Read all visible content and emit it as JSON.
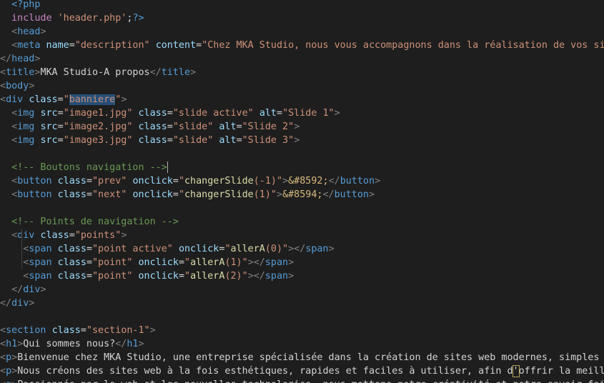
{
  "editor": {
    "language": "php",
    "lines": [
      [
        {
          "t": "  "
        },
        {
          "c": "tag",
          "t": "<?php"
        }
      ],
      [
        {
          "t": "  "
        },
        {
          "c": "php",
          "t": "include"
        },
        {
          "t": " "
        },
        {
          "c": "str",
          "t": "'header.php'"
        },
        {
          "t": ";"
        },
        {
          "c": "tag",
          "t": "?>"
        }
      ],
      [
        {
          "t": "  "
        },
        {
          "c": "punc",
          "t": "<"
        },
        {
          "c": "tag",
          "t": "head"
        },
        {
          "c": "punc",
          "t": ">"
        }
      ],
      [
        {
          "t": "  "
        },
        {
          "c": "punc",
          "t": "<"
        },
        {
          "c": "tag",
          "t": "meta"
        },
        {
          "t": " "
        },
        {
          "c": "attr",
          "t": "name"
        },
        {
          "t": "="
        },
        {
          "c": "str",
          "t": "\"description\""
        },
        {
          "t": " "
        },
        {
          "c": "attr",
          "t": "content"
        },
        {
          "t": "="
        },
        {
          "c": "str",
          "t": "\"Chez MKA Studio, nous vous accompagnons dans la réalisation de vos sites web"
        }
      ],
      [
        {
          "c": "punc",
          "t": "</"
        },
        {
          "c": "tag",
          "t": "head"
        },
        {
          "c": "punc",
          "t": ">"
        }
      ],
      [
        {
          "c": "punc",
          "t": "<"
        },
        {
          "c": "tag",
          "t": "title"
        },
        {
          "c": "punc",
          "t": ">"
        },
        {
          "c": "txt",
          "t": "MKA Studio-A propos"
        },
        {
          "c": "punc",
          "t": "</"
        },
        {
          "c": "tag",
          "t": "title"
        },
        {
          "c": "punc",
          "t": ">"
        }
      ],
      [
        {
          "c": "punc",
          "t": "<"
        },
        {
          "c": "tag",
          "t": "body"
        },
        {
          "c": "punc",
          "t": ">"
        }
      ],
      [
        {
          "c": "punc",
          "t": "<"
        },
        {
          "c": "tag",
          "t": "div"
        },
        {
          "t": " "
        },
        {
          "c": "attr",
          "t": "class"
        },
        {
          "t": "="
        },
        {
          "c": "str",
          "t": "\""
        },
        {
          "c": "str hl",
          "t": "banniere"
        },
        {
          "c": "str",
          "t": "\""
        },
        {
          "c": "punc",
          "t": ">"
        }
      ],
      [
        {
          "t": "  "
        },
        {
          "c": "punc",
          "t": "<"
        },
        {
          "c": "tag",
          "t": "img"
        },
        {
          "t": " "
        },
        {
          "c": "attr",
          "t": "src"
        },
        {
          "t": "="
        },
        {
          "c": "str",
          "t": "\"image1.jpg\""
        },
        {
          "t": " "
        },
        {
          "c": "attr",
          "t": "class"
        },
        {
          "t": "="
        },
        {
          "c": "str",
          "t": "\"slide active\""
        },
        {
          "t": " "
        },
        {
          "c": "attr",
          "t": "alt"
        },
        {
          "t": "="
        },
        {
          "c": "str",
          "t": "\"Slide 1\""
        },
        {
          "c": "punc",
          "t": ">"
        }
      ],
      [
        {
          "t": "  "
        },
        {
          "c": "punc",
          "t": "<"
        },
        {
          "c": "tag",
          "t": "img"
        },
        {
          "t": " "
        },
        {
          "c": "attr",
          "t": "src"
        },
        {
          "t": "="
        },
        {
          "c": "str",
          "t": "\"image2.jpg\""
        },
        {
          "t": " "
        },
        {
          "c": "attr",
          "t": "class"
        },
        {
          "t": "="
        },
        {
          "c": "str",
          "t": "\"slide\""
        },
        {
          "t": " "
        },
        {
          "c": "attr",
          "t": "alt"
        },
        {
          "t": "="
        },
        {
          "c": "str",
          "t": "\"Slide 2\""
        },
        {
          "c": "punc",
          "t": ">"
        }
      ],
      [
        {
          "t": "  "
        },
        {
          "c": "punc",
          "t": "<"
        },
        {
          "c": "tag",
          "t": "img"
        },
        {
          "t": " "
        },
        {
          "c": "attr",
          "t": "src"
        },
        {
          "t": "="
        },
        {
          "c": "str",
          "t": "\"image3.jpg\""
        },
        {
          "t": " "
        },
        {
          "c": "attr",
          "t": "class"
        },
        {
          "t": "="
        },
        {
          "c": "str",
          "t": "\"slide\""
        },
        {
          "t": " "
        },
        {
          "c": "attr",
          "t": "alt"
        },
        {
          "t": "="
        },
        {
          "c": "str",
          "t": "\"Slide 3\""
        },
        {
          "c": "punc",
          "t": ">"
        }
      ],
      [],
      [
        {
          "t": "  "
        },
        {
          "c": "cmt",
          "t": "<!-- Boutons navigation -->"
        }
      ],
      [
        {
          "t": "  "
        },
        {
          "c": "punc",
          "t": "<"
        },
        {
          "c": "tag",
          "t": "button"
        },
        {
          "t": " "
        },
        {
          "c": "attr",
          "t": "class"
        },
        {
          "t": "="
        },
        {
          "c": "str",
          "t": "\"prev\""
        },
        {
          "t": " "
        },
        {
          "c": "attr",
          "t": "onclick"
        },
        {
          "t": "="
        },
        {
          "c": "str",
          "t": "\""
        },
        {
          "c": "fn",
          "t": "changerSlide"
        },
        {
          "c": "str",
          "t": "(-1)\""
        },
        {
          "c": "punc",
          "t": ">"
        },
        {
          "c": "ent",
          "t": "&#8592;"
        },
        {
          "c": "punc",
          "t": "</"
        },
        {
          "c": "tag",
          "t": "button"
        },
        {
          "c": "punc",
          "t": ">"
        }
      ],
      [
        {
          "t": "  "
        },
        {
          "c": "punc",
          "t": "<"
        },
        {
          "c": "tag",
          "t": "button"
        },
        {
          "t": " "
        },
        {
          "c": "attr",
          "t": "class"
        },
        {
          "t": "="
        },
        {
          "c": "str",
          "t": "\"next\""
        },
        {
          "t": " "
        },
        {
          "c": "attr",
          "t": "onclick"
        },
        {
          "t": "="
        },
        {
          "c": "str",
          "t": "\""
        },
        {
          "c": "fn",
          "t": "changerSlide"
        },
        {
          "c": "str",
          "t": "(1)\""
        },
        {
          "c": "punc",
          "t": ">"
        },
        {
          "c": "ent",
          "t": "&#8594;"
        },
        {
          "c": "punc",
          "t": "</"
        },
        {
          "c": "tag",
          "t": "button"
        },
        {
          "c": "punc",
          "t": ">"
        }
      ],
      [],
      [
        {
          "t": "  "
        },
        {
          "c": "cmt",
          "t": "<!-- Points de navigation -->"
        }
      ],
      [
        {
          "t": "  "
        },
        {
          "c": "punc",
          "t": "<"
        },
        {
          "c": "tag",
          "t": "div"
        },
        {
          "t": " "
        },
        {
          "c": "attr",
          "t": "class"
        },
        {
          "t": "="
        },
        {
          "c": "str",
          "t": "\"points\""
        },
        {
          "c": "punc",
          "t": ">"
        }
      ],
      [
        {
          "t": "    "
        },
        {
          "c": "punc",
          "t": "<"
        },
        {
          "c": "tag",
          "t": "span"
        },
        {
          "t": " "
        },
        {
          "c": "attr",
          "t": "class"
        },
        {
          "t": "="
        },
        {
          "c": "str",
          "t": "\"point active\""
        },
        {
          "t": " "
        },
        {
          "c": "attr",
          "t": "onclick"
        },
        {
          "t": "="
        },
        {
          "c": "str",
          "t": "\""
        },
        {
          "c": "fn",
          "t": "allerA"
        },
        {
          "c": "str",
          "t": "(0)\""
        },
        {
          "c": "punc",
          "t": "></"
        },
        {
          "c": "tag",
          "t": "span"
        },
        {
          "c": "punc",
          "t": ">"
        }
      ],
      [
        {
          "t": "    "
        },
        {
          "c": "punc",
          "t": "<"
        },
        {
          "c": "tag",
          "t": "span"
        },
        {
          "t": " "
        },
        {
          "c": "attr",
          "t": "class"
        },
        {
          "t": "="
        },
        {
          "c": "str",
          "t": "\"point\""
        },
        {
          "t": " "
        },
        {
          "c": "attr",
          "t": "onclick"
        },
        {
          "t": "="
        },
        {
          "c": "str",
          "t": "\""
        },
        {
          "c": "fn",
          "t": "allerA"
        },
        {
          "c": "str",
          "t": "(1)\""
        },
        {
          "c": "punc",
          "t": "></"
        },
        {
          "c": "tag",
          "t": "span"
        },
        {
          "c": "punc",
          "t": ">"
        }
      ],
      [
        {
          "t": "    "
        },
        {
          "c": "punc",
          "t": "<"
        },
        {
          "c": "tag",
          "t": "span"
        },
        {
          "t": " "
        },
        {
          "c": "attr",
          "t": "class"
        },
        {
          "t": "="
        },
        {
          "c": "str",
          "t": "\"point\""
        },
        {
          "t": " "
        },
        {
          "c": "attr",
          "t": "onclick"
        },
        {
          "t": "="
        },
        {
          "c": "str",
          "t": "\""
        },
        {
          "c": "fn",
          "t": "allerA"
        },
        {
          "c": "str",
          "t": "(2)\""
        },
        {
          "c": "punc",
          "t": "></"
        },
        {
          "c": "tag",
          "t": "span"
        },
        {
          "c": "punc",
          "t": ">"
        }
      ],
      [
        {
          "t": "  "
        },
        {
          "c": "punc",
          "t": "</"
        },
        {
          "c": "tag",
          "t": "div"
        },
        {
          "c": "punc",
          "t": ">"
        }
      ],
      [
        {
          "c": "punc",
          "t": "</"
        },
        {
          "c": "tag",
          "t": "div"
        },
        {
          "c": "punc",
          "t": ">"
        }
      ],
      [],
      [
        {
          "c": "punc",
          "t": "<"
        },
        {
          "c": "tag",
          "t": "section"
        },
        {
          "t": " "
        },
        {
          "c": "attr",
          "t": "class"
        },
        {
          "t": "="
        },
        {
          "c": "str",
          "t": "\"section-1\""
        },
        {
          "c": "punc",
          "t": ">"
        }
      ],
      [
        {
          "c": "punc",
          "t": "<"
        },
        {
          "c": "tag",
          "t": "h1"
        },
        {
          "c": "punc",
          "t": ">"
        },
        {
          "c": "txt",
          "t": "Qui sommes nous?"
        },
        {
          "c": "punc",
          "t": "</"
        },
        {
          "c": "tag",
          "t": "h1"
        },
        {
          "c": "punc",
          "t": ">"
        }
      ],
      [
        {
          "c": "punc",
          "t": "<"
        },
        {
          "c": "tag",
          "t": "p"
        },
        {
          "c": "punc",
          "t": ">"
        },
        {
          "c": "txt",
          "t": "Bienvenue chez MKA Studio, une entreprise spécialisée dans la création de sites web modernes, simples et eff"
        }
      ],
      [
        {
          "c": "punc",
          "t": "<"
        },
        {
          "c": "tag",
          "t": "p"
        },
        {
          "c": "punc",
          "t": ">"
        },
        {
          "c": "txt",
          "t": "Nous créons des sites web à la fois esthétiques, rapides et faciles à utiliser, afin d"
        },
        {
          "c": "txt boxed",
          "t": "'"
        },
        {
          "c": "txt",
          "t": "offrir la meilleure e"
        }
      ],
      [
        {
          "c": "punc",
          "t": "<"
        },
        {
          "c": "tag",
          "t": "p"
        },
        {
          "c": "punc",
          "t": ">"
        },
        {
          "c": "txt",
          "t": "Passionnés par le web et les nouvelles technologies, nous mettons notre créativité et notre savoir-faire"
        }
      ]
    ]
  }
}
